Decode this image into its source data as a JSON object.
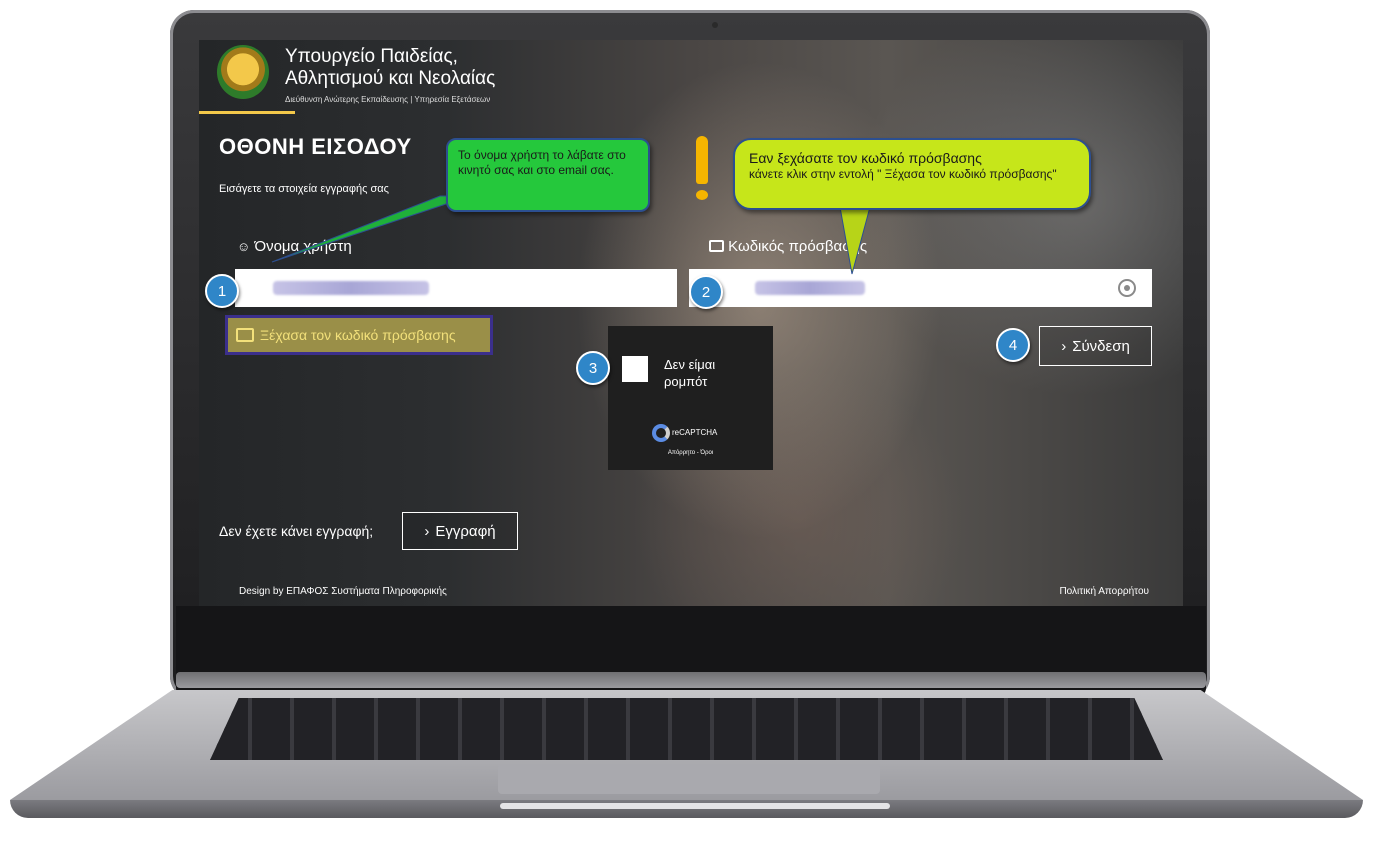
{
  "colors": {
    "accent_yellow": "#f3c84a",
    "callout_green": "#25c83c",
    "callout_lime": "#c6e61a",
    "badge_blue": "#2f86c8",
    "forgot_border": "#3b2f8c"
  },
  "header": {
    "org_name_line1": "Υπουργείο Παιδείας,",
    "org_name_line2": "Αθλητισμού και Νεολαίας",
    "org_subtitle": "Διεύθυνση Ανώτερης Εκπαίδευσης | Υπηρεσία Εξετάσεων",
    "logo_icon": "cyprus-emblem-icon"
  },
  "login": {
    "title": "ΟΘΟΝΗ ΕΙΣΟΔΟΥ",
    "subtitle": "Εισάγετε τα στοιχεία εγγραφής σας",
    "username_label": "Όνομα χρήστη",
    "username_value": "abcdefgh",
    "username_icon": "user-icon",
    "password_label": "Κωδικός πρόσβασης",
    "password_value": "abcdefgh",
    "password_icon": "lock-icon",
    "show_password_icon": "eye-icon",
    "forgot_label": "Ξέχασα τον κωδικό πρόσβασης",
    "forgot_icon": "lock-icon",
    "login_button": "Σύνδεση",
    "register_question": "Δεν έχετε κάνει εγγραφή;",
    "register_button": "Εγγραφή",
    "chevron": "›"
  },
  "captcha": {
    "label": "Δεν είμαι ρομπότ",
    "brand": "reCAPTCHA",
    "links": "Απόρρητο - Όροι"
  },
  "footer": {
    "left": "Design by ΕΠΑΦΟΣ Συστήματα Πληροφορικής",
    "right": "Πολιτική Απορρήτου"
  },
  "annotations": {
    "callout_username": "Το όνομα χρήστη το λάβατε στο κινητό σας και στο email σας.",
    "callout_password_line1": "Εαν ξεχάσατε τον κωδικό πρόσβασης",
    "callout_password_line2": "κάνετε κλικ στην εντολή \" Ξέχασα τον κωδικό πρόσβασης\"",
    "badges": [
      "1",
      "2",
      "3",
      "4"
    ]
  }
}
